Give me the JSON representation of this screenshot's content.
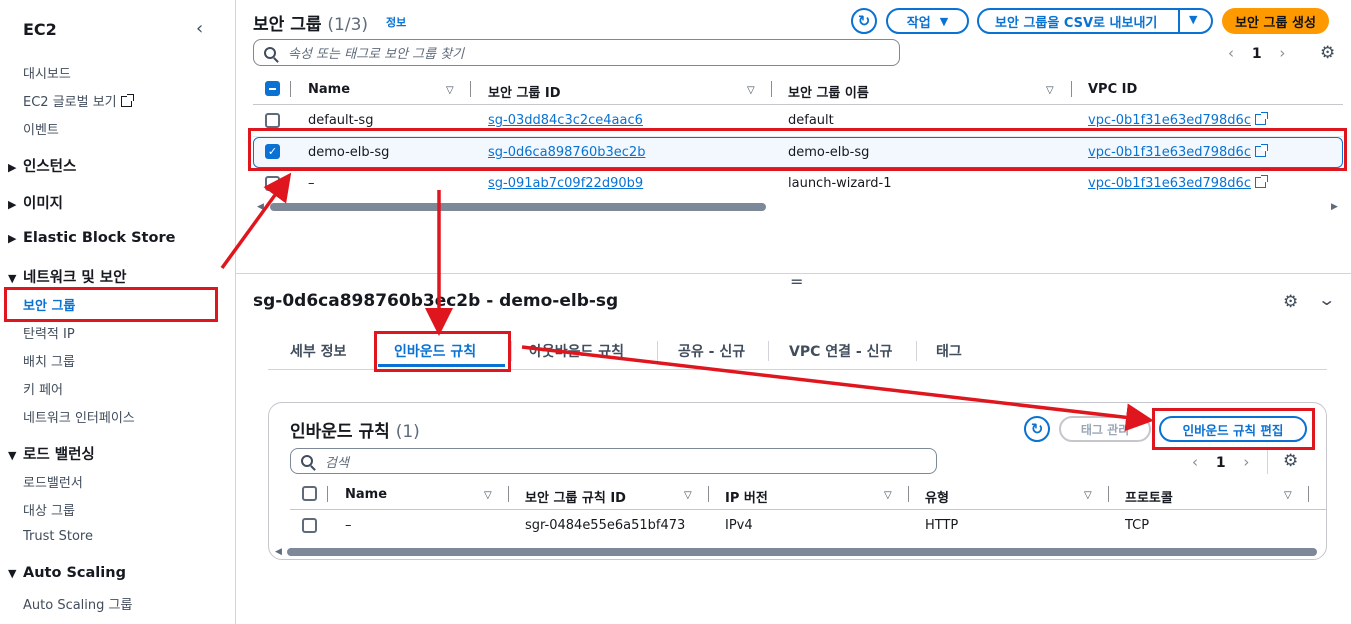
{
  "sidebar": {
    "title": "EC2",
    "links_top": [
      "대시보드",
      "EC2 글로벌 보기",
      "이벤트"
    ],
    "sections": {
      "instances": "인스턴스",
      "images": "이미지",
      "ebs": "Elastic Block Store",
      "network": "네트워크 및 보안",
      "lb": "로드 밸런싱",
      "asg": "Auto Scaling"
    },
    "network_items": [
      "보안 그룹",
      "탄력적 IP",
      "배치 그룹",
      "키 페어",
      "네트워크 인터페이스"
    ],
    "lb_items": [
      "로드밸런서",
      "대상 그룹",
      "Trust Store"
    ],
    "asg_items": [
      "Auto Scaling 그룹"
    ]
  },
  "header": {
    "title": "보안 그룹",
    "count": "(1/3)",
    "info": "정보",
    "actions_label": "작업",
    "export_label": "보안 그룹을 CSV로 내보내기",
    "create_label": "보안 그룹 생성",
    "search_placeholder": "속성 또는 태그로 보안 그룹 찾기",
    "page": "1"
  },
  "table": {
    "columns": [
      "Name",
      "보안 그룹 ID",
      "보안 그룹 이름",
      "VPC ID"
    ],
    "rows": [
      {
        "name": "default-sg",
        "id": "sg-03dd84c3c2ce4aac6",
        "group_name": "default",
        "vpc": "vpc-0b1f31e63ed798d6c"
      },
      {
        "name": "demo-elb-sg",
        "id": "sg-0d6ca898760b3ec2b",
        "group_name": "demo-elb-sg",
        "vpc": "vpc-0b1f31e63ed798d6c"
      },
      {
        "name": "–",
        "id": "sg-091ab7c09f22d90b9",
        "group_name": "launch-wizard-1",
        "vpc": "vpc-0b1f31e63ed798d6c"
      }
    ]
  },
  "detail": {
    "title": "sg-0d6ca898760b3ec2b - demo-elb-sg",
    "tabs": [
      "세부 정보",
      "인바운드 규칙",
      "아웃바운드 규칙",
      "공유 - 신규",
      "VPC 연결 - 신규",
      "태그"
    ],
    "resize_handle": "=",
    "panel": {
      "title": "인바운드 규칙",
      "count": "(1)",
      "manage_tags": "태그 관리",
      "edit_inbound": "인바운드 규칙 편집",
      "search_placeholder": "검색",
      "page": "1",
      "columns": [
        "Name",
        "보안 그룹 규칙 ID",
        "IP 버전",
        "유형",
        "프로토콜"
      ],
      "row": {
        "name": "–",
        "rule_id": "sgr-0484e55e6a51bf473",
        "ip_version": "IPv4",
        "type": "HTTP",
        "protocol": "TCP"
      }
    }
  },
  "colors": {
    "accent": "#0972d3",
    "primary": "#ff9900",
    "highlight": "#e0161e"
  }
}
